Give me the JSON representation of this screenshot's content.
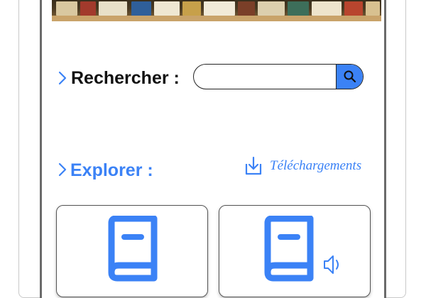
{
  "search": {
    "label": "Rechercher :",
    "value": "",
    "placeholder": ""
  },
  "explore": {
    "label": "Explorer :"
  },
  "downloads": {
    "label": "Téléchargements"
  },
  "colors": {
    "accent": "#3b82f6",
    "text": "#111111",
    "border": "#222222"
  },
  "icons": {
    "search_button": "search-icon",
    "downloads": "download-icon",
    "card_books": "book-icon",
    "card_audiobooks": "audiobook-icon"
  }
}
